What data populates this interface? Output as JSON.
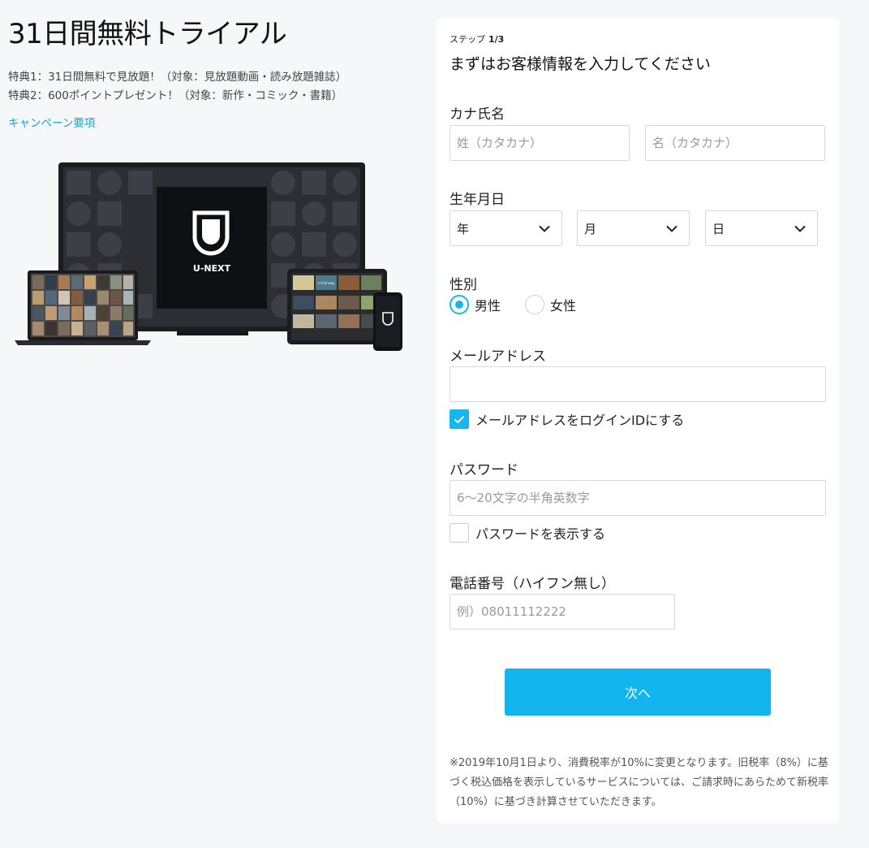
{
  "promo": {
    "title": "31日間無料トライアル",
    "benefit1": "特典1：31日間無料で見放題！（対象：見放題動画・読み放題雑誌）",
    "benefit2": "特典2：600ポイントプレゼント！（対象：新作・コミック・書籍）",
    "campaign_link": "キャンペーン要項",
    "brand_logo_text": "U-NEXT",
    "tablet_tile_text": "a trial way"
  },
  "form": {
    "step_label": "ステップ",
    "step_value": "1/3",
    "heading": "まずはお客様情報を入力してください",
    "kana_label": "カナ氏名",
    "last_name_placeholder": "姓（カタカナ）",
    "first_name_placeholder": "名（カタカナ）",
    "birthdate_label": "生年月日",
    "year_value": "年",
    "month_value": "月",
    "day_value": "日",
    "gender_label": "性別",
    "gender_male": "男性",
    "gender_female": "女性",
    "gender_selected": "male",
    "email_label": "メールアドレス",
    "email_value": "",
    "use_email_as_id_label": "メールアドレスをログインIDにする",
    "use_email_as_id_checked": true,
    "password_label": "パスワード",
    "password_placeholder": "6～20文字の半角英数字",
    "show_password_label": "パスワードを表示する",
    "show_password_checked": false,
    "phone_label": "電話番号（ハイフン無し）",
    "phone_placeholder": "例）08011112222",
    "next_button": "次へ",
    "tax_note": "※2019年10月1日より、消費税率が10%に変更となります。旧税率（8%）に基づく税込価格を表示しているサービスについては、ご請求時にあらためて新税率（10%）に基づき計算させていただきます。"
  },
  "colors": {
    "accent": "#13b5ef",
    "link": "#16a4d6",
    "background": "#f6f7f9",
    "panel": "#ffffff"
  },
  "icons": [
    "chevron-down-icon",
    "check-icon",
    "u-next-logo"
  ]
}
